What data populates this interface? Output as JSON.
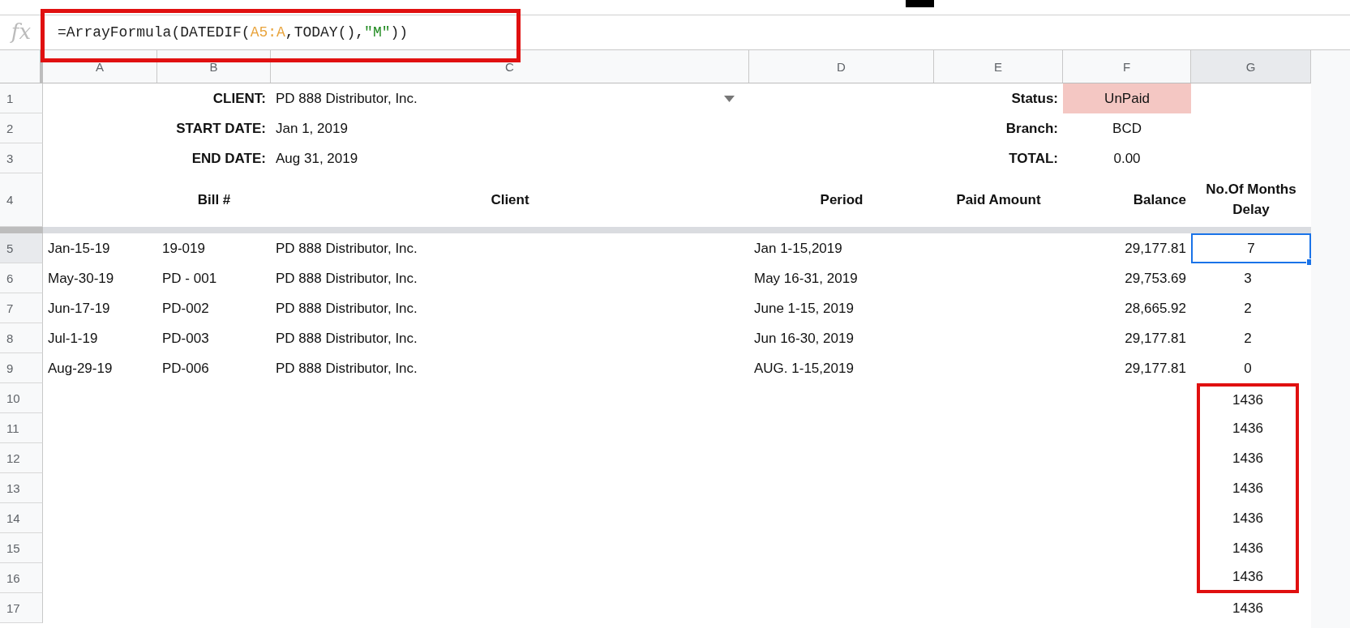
{
  "formula_bar": {
    "icon": "fx",
    "highlighted": true,
    "segments": [
      {
        "kind": "plain",
        "text": "=ArrayFormula(DATEDIF("
      },
      {
        "kind": "range",
        "text": "A5:A"
      },
      {
        "kind": "plain",
        "text": ",TODAY(),"
      },
      {
        "kind": "string",
        "text": "\"M\""
      },
      {
        "kind": "plain",
        "text": "))"
      }
    ]
  },
  "columns": [
    {
      "label": "A",
      "selected": false
    },
    {
      "label": "B",
      "selected": false
    },
    {
      "label": "C",
      "selected": false
    },
    {
      "label": "D",
      "selected": false
    },
    {
      "label": "E",
      "selected": false
    },
    {
      "label": "F",
      "selected": false
    },
    {
      "label": "G",
      "selected": true
    }
  ],
  "summary": [
    {
      "row": "1",
      "label": "CLIENT:",
      "value": "PD 888 Distributor, Inc.",
      "dropdown": true,
      "right_label": "Status:",
      "right_value": "UnPaid",
      "highlighted": true
    },
    {
      "row": "2",
      "label": "START DATE:",
      "value": "Jan 1, 2019",
      "dropdown": false,
      "right_label": "Branch:",
      "right_value": "BCD",
      "highlighted": false
    },
    {
      "row": "3",
      "label": "END DATE:",
      "value": "Aug 31, 2019",
      "dropdown": false,
      "right_label": "TOTAL:",
      "right_value": "0.00",
      "highlighted": false
    }
  ],
  "headings": {
    "row": "4",
    "bill": "Bill #",
    "client": "Client",
    "period": "Period",
    "paid": "Paid Amount",
    "balance": "Balance",
    "months": "No.Of Months Delay"
  },
  "rows": [
    {
      "row": "5",
      "selected": true,
      "highlighted": false,
      "date": "Jan-15-19",
      "bill": "19-019",
      "client": "PD 888 Distributor, Inc.",
      "period": "Jan 1-15,2019",
      "balance": "29,177.81",
      "months": "7"
    },
    {
      "row": "6",
      "selected": false,
      "highlighted": false,
      "date": "May-30-19",
      "bill": "PD - 001",
      "client": "PD 888 Distributor, Inc.",
      "period": "May 16-31, 2019",
      "balance": "29,753.69",
      "months": "3"
    },
    {
      "row": "7",
      "selected": false,
      "highlighted": false,
      "date": "Jun-17-19",
      "bill": "PD-002",
      "client": "PD 888 Distributor, Inc.",
      "period": "June 1-15, 2019",
      "balance": "28,665.92",
      "months": "2"
    },
    {
      "row": "8",
      "selected": false,
      "highlighted": false,
      "date": "Jul-1-19",
      "bill": "PD-003",
      "client": "PD 888 Distributor, Inc.",
      "period": "Jun 16-30, 2019",
      "balance": "29,177.81",
      "months": "2"
    },
    {
      "row": "9",
      "selected": false,
      "highlighted": false,
      "date": "Aug-29-19",
      "bill": "PD-006",
      "client": "PD 888 Distributor, Inc.",
      "period": "AUG. 1-15,2019",
      "balance": "29,177.81",
      "months": "0"
    },
    {
      "row": "10",
      "selected": false,
      "highlighted": true,
      "months": "1436"
    },
    {
      "row": "11",
      "selected": false,
      "highlighted": true,
      "months": "1436"
    },
    {
      "row": "12",
      "selected": false,
      "highlighted": true,
      "months": "1436"
    },
    {
      "row": "13",
      "selected": false,
      "highlighted": true,
      "months": "1436"
    },
    {
      "row": "14",
      "selected": false,
      "highlighted": true,
      "months": "1436"
    },
    {
      "row": "15",
      "selected": false,
      "highlighted": true,
      "months": "1436"
    },
    {
      "row": "16",
      "selected": false,
      "highlighted": true,
      "months": "1436"
    },
    {
      "row": "17",
      "selected": false,
      "highlighted": false,
      "months": "1436"
    }
  ]
}
